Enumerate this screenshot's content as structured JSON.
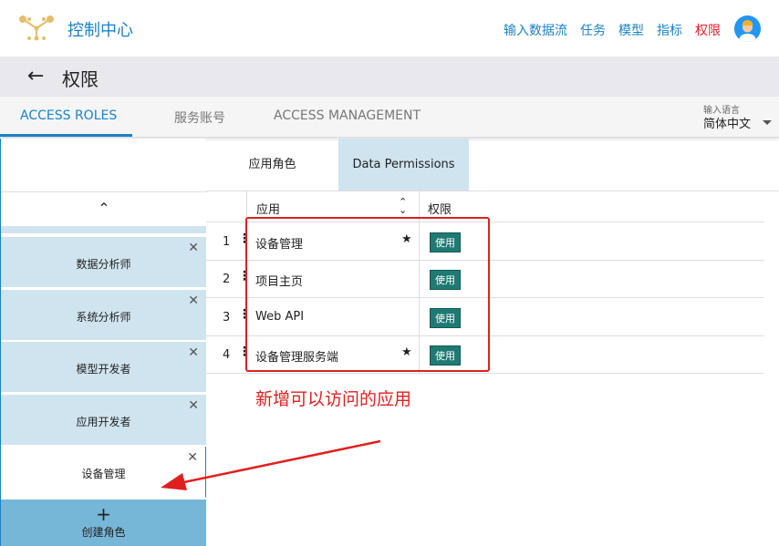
{
  "header": {
    "title": "控制中心",
    "nav": [
      "输入数据流",
      "任务",
      "模型",
      "指标",
      "权限"
    ],
    "active_nav": "权限"
  },
  "page": {
    "title": "权限"
  },
  "tabs": [
    "ACCESS ROLES",
    "服务账号",
    "ACCESS MANAGEMENT"
  ],
  "language": {
    "label": "输入语言",
    "value": "简体中文"
  },
  "roles": [
    "数据分析师",
    "系统分析师",
    "模型开发者",
    "应用开发者",
    "设备管理"
  ],
  "selected_role": "设备管理",
  "create_role": {
    "icon": "+",
    "label": "创建角色"
  },
  "subtabs": [
    "应用角色",
    "Data Permissions"
  ],
  "table": {
    "headers": [
      "应用",
      "权限"
    ],
    "rows": [
      {
        "num": "1",
        "name": "设备管理",
        "starred": true,
        "permission": "使用"
      },
      {
        "num": "2",
        "name": "项目主页",
        "starred": false,
        "permission": "使用"
      },
      {
        "num": "3",
        "name": "Web API",
        "starred": false,
        "permission": "使用"
      },
      {
        "num": "4",
        "name": "设备管理服务端",
        "starred": true,
        "permission": "使用"
      }
    ]
  },
  "annotation": "新增可以访问的应用",
  "colors": {
    "accent": "#1a82c6",
    "active_nav": "#e0222b",
    "badge": "#1f7a73",
    "role_bg": "#cfe4ef",
    "annotation": "#e02020"
  }
}
